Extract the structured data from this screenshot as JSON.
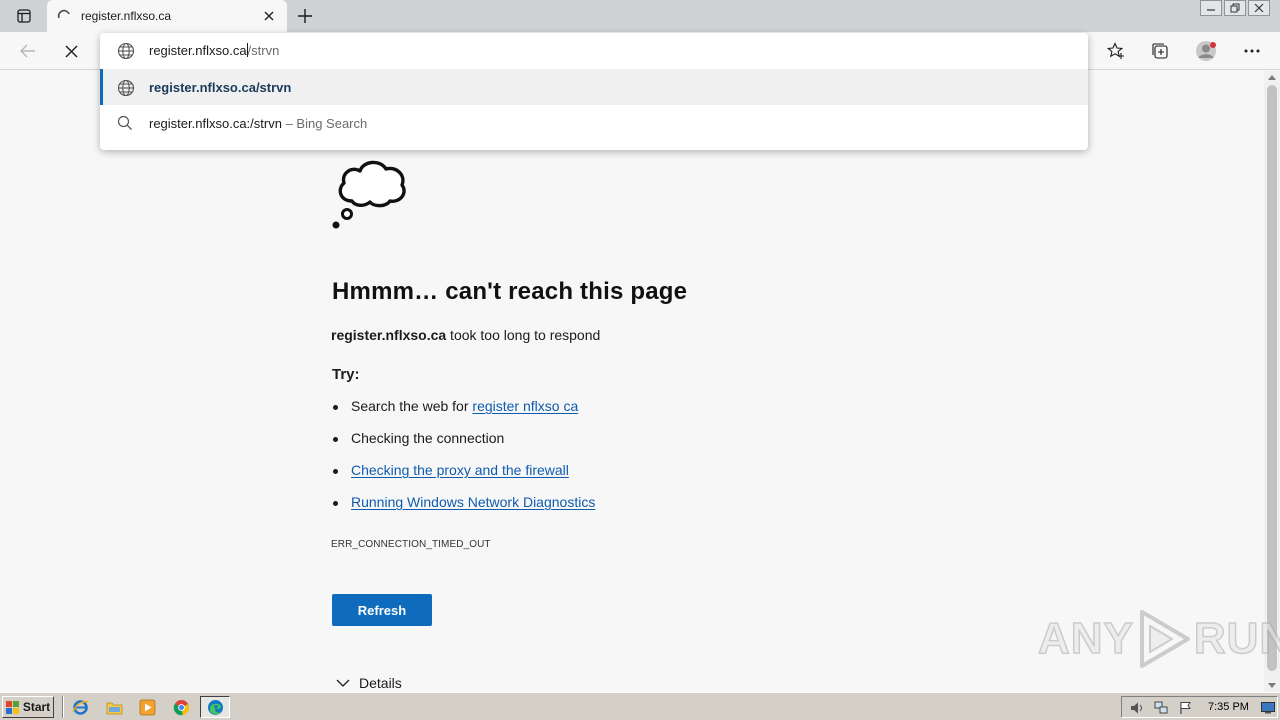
{
  "browser": {
    "tab": {
      "title": "register.nflxso.ca"
    },
    "omnibox": {
      "typed": "register.nflxso.ca",
      "autocomplete": "/strvn",
      "suggestions": [
        {
          "text": "register.nflxso.ca/strvn",
          "type": "url"
        },
        {
          "text": "register.nflxso.ca:/strvn",
          "hint": "– Bing Search",
          "type": "search"
        }
      ]
    }
  },
  "error_page": {
    "title": "Hmmm… can't reach this page",
    "host": "register.nflxso.ca",
    "description_rest": " took too long to respond",
    "try_label": "Try:",
    "tips": {
      "search_prefix": "Search the web for ",
      "search_link": "register nflxso ca",
      "connection": "Checking the connection",
      "proxy": "Checking the proxy and the firewall",
      "diagnostics": "Running Windows Network Diagnostics"
    },
    "error_code": "ERR_CONNECTION_TIMED_OUT",
    "refresh_label": "Refresh",
    "details_label": "Details"
  },
  "watermark": {
    "left": "ANY",
    "right": "RUN"
  },
  "taskbar": {
    "start_label": "Start",
    "clock": "7:35 PM",
    "pinned": [
      "ie-icon",
      "explorer-icon",
      "media-player-icon",
      "chrome-icon",
      "edge-icon"
    ]
  },
  "colors": {
    "accent": "#0f6cbd",
    "link": "#0f5bb0",
    "tabstrip": "#cfd3d6",
    "taskbar": "#d4d0c8"
  }
}
